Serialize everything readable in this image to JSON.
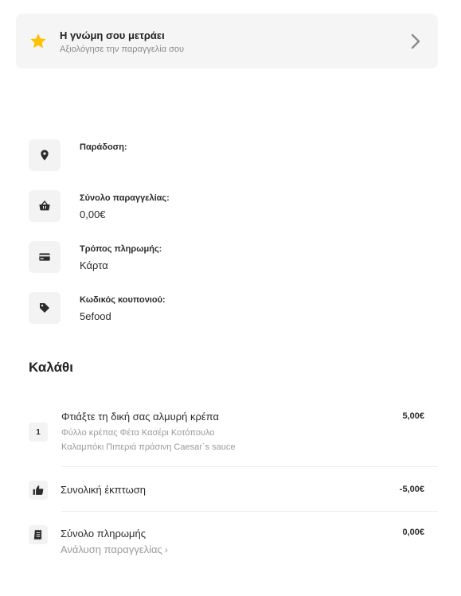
{
  "rating": {
    "title": "Η γνώμη σου μετράει",
    "subtitle": "Αξιολόγησε την παραγγελία σου",
    "star_color": "#FFC107"
  },
  "info": [
    {
      "icon": "location-pin-icon",
      "label": "Παράδοση:",
      "value": ""
    },
    {
      "icon": "basket-icon",
      "label": "Σύνολο παραγγελίας:",
      "value": "0,00€"
    },
    {
      "icon": "credit-card-icon",
      "label": "Τρόπος πληρωμής:",
      "value": "Κάρτα"
    },
    {
      "icon": "tag-icon",
      "label": "Κωδικός κουπονιού:",
      "value": "5efood"
    }
  ],
  "cart": {
    "title": "Καλάθι",
    "item": {
      "quantity": "1",
      "name": "Φτιάξτε τη δική σας αλμυρή κρέπα",
      "desc_line1": "Φύλλο κρέπας Φέτα Κασέρι Κοτόπουλο",
      "desc_line2": "Καλαμπόκι Πιπεριά πράσινη Caesar`s sauce",
      "price": "5,00€"
    },
    "discount": {
      "icon": "thumbs-up-icon",
      "label": "Συνολική έκπτωση",
      "value": "-5,00€"
    },
    "total": {
      "icon": "receipt-icon",
      "label": "Σύνολο πληρωμής",
      "value": "0,00€",
      "link": "Ανάλυση παραγγελίας"
    }
  }
}
